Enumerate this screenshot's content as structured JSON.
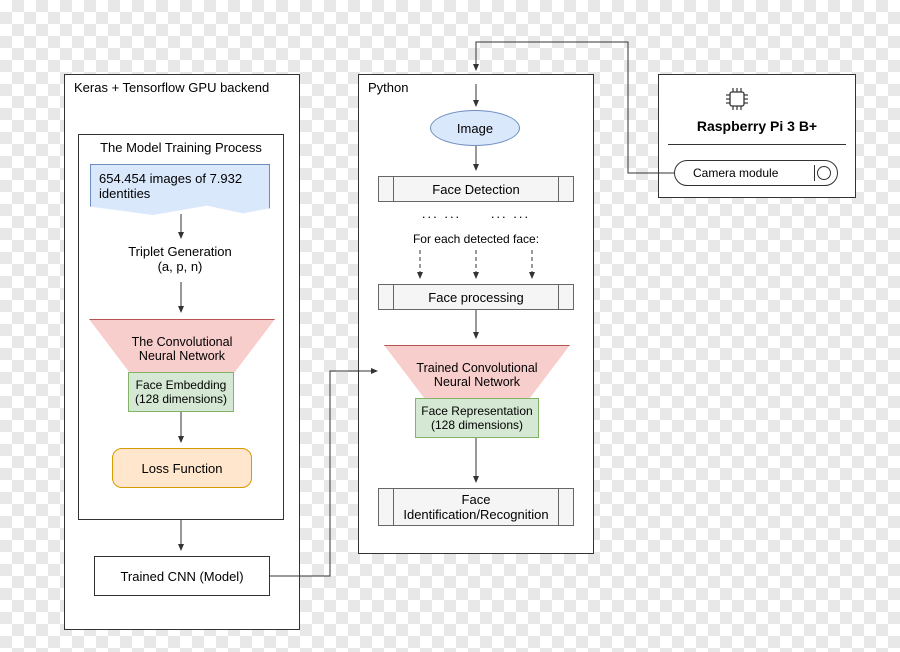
{
  "left": {
    "title": "Keras + Tensorflow GPU backend",
    "inner_title": "The Model Training Process",
    "dataset": "654.454 images of 7.932 identities",
    "triplet1": "Triplet Generation",
    "triplet2": "(a, p, n)",
    "cnn": "The Convolutional Neural Network",
    "embed1": "Face Embedding",
    "embed2": "(128 dimensions)",
    "loss": "Loss Function",
    "trained": "Trained CNN (Model)"
  },
  "mid": {
    "title": "Python",
    "image": "Image",
    "detect": "Face Detection",
    "dots1": "...  ...",
    "dots2": "...  ...",
    "for_each": "For each detected face:",
    "process": "Face processing",
    "cnn": "Trained Convolutional Neural Network",
    "rep1": "Face Representation",
    "rep2": "(128 dimensions)",
    "ident": "Face Identification/Recognition"
  },
  "right": {
    "title": "Raspberry Pi 3 B+",
    "camera": "Camera module"
  }
}
